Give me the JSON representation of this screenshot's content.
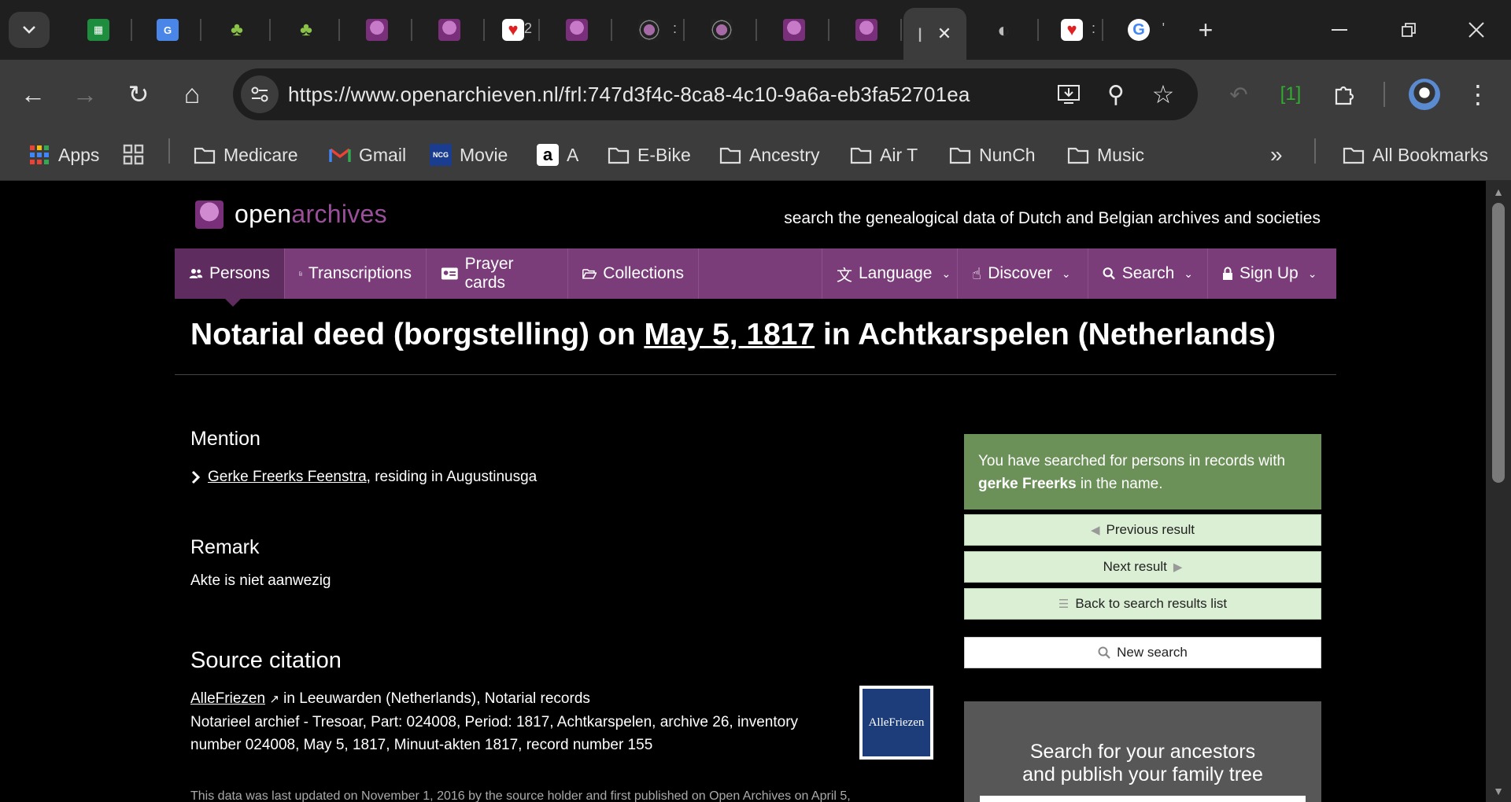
{
  "browser": {
    "url": "https://www.openarchieven.nl/frl:747d3f4c-8ca8-4c10-9a6a-eb3fa52701ea",
    "extension_badge": "[1]",
    "tab_clip_glyphs": [
      "2",
      ":",
      ":",
      ":",
      "'"
    ],
    "bookmarks": [
      "Apps",
      "Medicare",
      "Gmail",
      "Movie",
      "A",
      "E-Bike",
      "Ancestry",
      "Air T",
      "NunCh",
      "Music",
      "All Bookmarks"
    ],
    "icon_glyphs": {
      "back": "←",
      "forward": "→",
      "reload": "↻",
      "home": "⌂",
      "zoom": "⚲",
      "star": "☆",
      "more": "⋮",
      "overflow": "»",
      "new_tab": "+",
      "close": "✕"
    }
  },
  "site": {
    "brand_part1": "open",
    "brand_part2": "archives",
    "tagline": "search the genealogical data of Dutch and Belgian archives and societies",
    "nav": {
      "persons": "Persons",
      "transcriptions": "Transcriptions",
      "prayer_cards": "Prayer cards",
      "collections": "Collections",
      "language": "Language",
      "discover": "Discover",
      "search": "Search",
      "signup": "Sign Up"
    }
  },
  "record": {
    "title_pre": "Notarial deed (borgstelling) on ",
    "title_date": "May 5, 1817",
    "title_post": " in Achtkarspelen (Netherlands)",
    "mention_heading": "Mention",
    "person_name": "Gerke Freerks Feenstra",
    "person_residence": ", residing in Augustinusga",
    "remark_heading": "Remark",
    "remark_text": "Akte is niet aanwezig",
    "source_heading": "Source citation",
    "source_link": "AlleFriezen",
    "source_line1_rest": " in Leeuwarden (Netherlands), Notarial records",
    "source_line2": "Notarieel archief - Tresoar, Part: 024008, Period: 1817, Achtkarspelen, archive 26, inventory",
    "source_line3": "number 024008, May 5, 1817, Minuut-akten 1817, record number 155",
    "badge_text": "AlleFriezen",
    "footnote": "This data was last updated on November 1, 2016 by the source holder and first published on Open Archives on April 5,"
  },
  "sidebar": {
    "searched_pre": "You have searched for persons in records with",
    "searched_term": "gerke Freerks",
    "searched_post": " in the name.",
    "prev": "Previous result",
    "next": "Next result",
    "back": "Back to search results list",
    "new_search": "New search",
    "promo_line1": "Search for your ancestors",
    "promo_line2": "and publish your family tree"
  }
}
